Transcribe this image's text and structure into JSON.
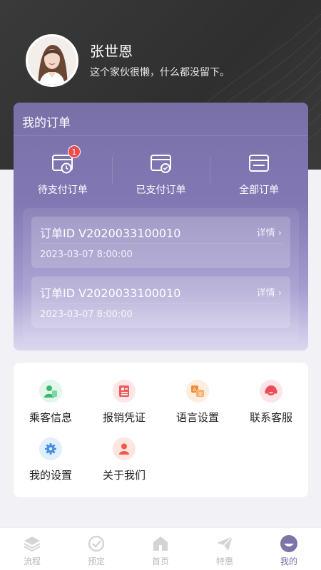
{
  "profile": {
    "name": "张世恩",
    "bio": "这个家伙很懒，什么都没留下。"
  },
  "orders": {
    "title": "我的订单",
    "tabs": [
      {
        "label": "待支付订单",
        "icon": "wallet-clock-icon",
        "badge": "1"
      },
      {
        "label": "已支付订单",
        "icon": "card-check-icon"
      },
      {
        "label": "全部订单",
        "icon": "card-icon"
      }
    ],
    "items": [
      {
        "id": "订单ID V2020033100010",
        "detail": "详情",
        "time": "2023-03-07   8:00:00"
      },
      {
        "id": "订单ID V2020033100010",
        "detail": "详情",
        "time": "2023-03-07   8:00:00"
      }
    ]
  },
  "features": [
    {
      "label": "乘客信息",
      "icon": "passenger-icon",
      "color": "#3bb873",
      "bg": "#e3f6ea"
    },
    {
      "label": "报销凭证",
      "icon": "receipt-icon",
      "color": "#ef5b5b",
      "bg": "#fde6e6"
    },
    {
      "label": "语言设置",
      "icon": "language-icon",
      "color": "#f08a3c",
      "bg": "#fdeedd"
    },
    {
      "label": "联系客服",
      "icon": "customer-service-icon",
      "color": "#ee4a58",
      "bg": "#fde4e6"
    },
    {
      "label": "我的设置",
      "icon": "settings-gear-icon",
      "color": "#3f8ee8",
      "bg": "#e1eefc"
    },
    {
      "label": "关于我们",
      "icon": "about-person-icon",
      "color": "#ef5b45",
      "bg": "#fde6e2"
    }
  ],
  "nav": [
    {
      "label": "流程",
      "icon": "layers-icon"
    },
    {
      "label": "预定",
      "icon": "booking-check-icon"
    },
    {
      "label": "首页",
      "icon": "home-icon"
    },
    {
      "label": "特惠",
      "icon": "paper-plane-icon"
    },
    {
      "label": "我的",
      "icon": "profile-face-icon",
      "active": true
    }
  ],
  "colors": {
    "accent": "#7c73a8",
    "badge": "#ee4b4b"
  }
}
